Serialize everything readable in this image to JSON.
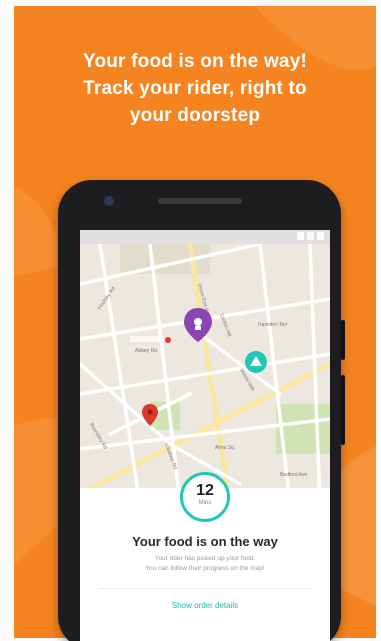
{
  "headline": {
    "line1": "Your food is on the way!",
    "line2": "Track your rider, right to",
    "line3": "your doorstep"
  },
  "colors": {
    "brand_orange": "#f58420",
    "accent_teal": "#20c6b6",
    "rider_purple": "#8a45b0",
    "destination_red": "#d83a2e"
  },
  "map": {
    "icons": [
      "restaurant-pin-icon",
      "rider-bike-icon",
      "destination-pin-icon"
    ],
    "street_labels": [
      "Finchley Rd",
      "Grove End Rd",
      "Abbey Rd",
      "Hamilton Terr",
      "Carlton Hill",
      "Maida Vale",
      "Boundary Rd",
      "Loudoun Rd",
      "Bedford Ave",
      "Alma Sq"
    ]
  },
  "tracker": {
    "minutes": "12",
    "unit": "Mins",
    "title": "Your food is on the way",
    "desc_line1": "Your rider has picked up your food.",
    "desc_line2": "You can follow their progress on the map!",
    "link": "Show order details"
  }
}
